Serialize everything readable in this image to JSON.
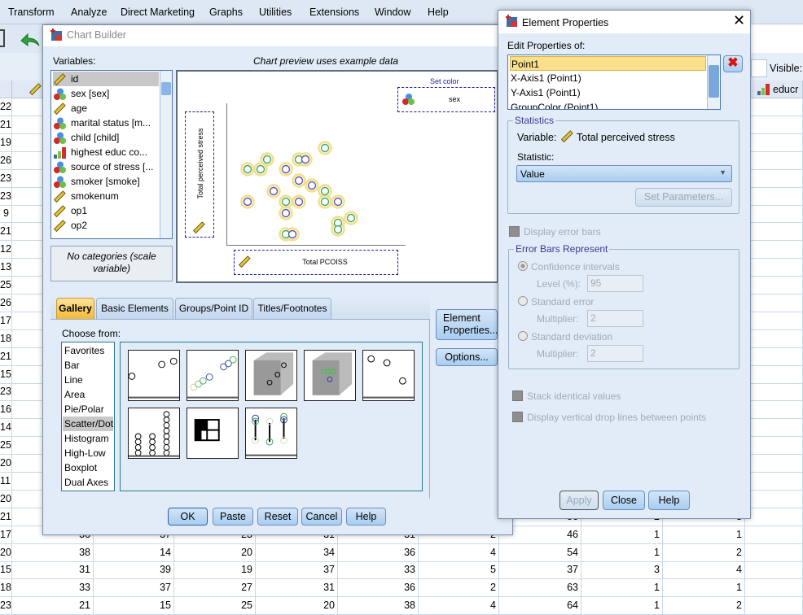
{
  "menu": [
    "Transform",
    "Analyze",
    "Direct Marketing",
    "Graphs",
    "Utilities",
    "Extensions",
    "Window",
    "Help"
  ],
  "data_editor": {
    "visible_label": "Visible:",
    "right_column_header": "educr",
    "first_column_values": [
      "22",
      "21",
      "19",
      "26",
      "23",
      "23",
      "9",
      "21",
      "12",
      "13",
      "25",
      "26",
      "17",
      "18",
      "21",
      "15",
      "23",
      "16",
      "14",
      "25",
      "20",
      "11",
      "20",
      "21",
      "17",
      "20",
      "15",
      "18",
      "23"
    ],
    "bottom_rows": [
      [
        "",
        "",
        "",
        "",
        "",
        "",
        "56",
        "2",
        "3"
      ],
      [
        "36",
        "37",
        "23",
        "31",
        "31",
        "2",
        "46",
        "1",
        "1"
      ],
      [
        "38",
        "14",
        "20",
        "34",
        "36",
        "4",
        "54",
        "1",
        "2"
      ],
      [
        "31",
        "39",
        "19",
        "37",
        "33",
        "5",
        "37",
        "3",
        "4"
      ],
      [
        "33",
        "37",
        "27",
        "31",
        "36",
        "2",
        "63",
        "1",
        "1"
      ],
      [
        "21",
        "15",
        "25",
        "20",
        "38",
        "4",
        "64",
        "1",
        "2"
      ]
    ]
  },
  "chart_builder": {
    "title": "Chart Builder",
    "variables_label": "Variables:",
    "preview_label": "Chart preview uses example data",
    "variables": [
      {
        "label": "id",
        "icon": "scale"
      },
      {
        "label": "sex [sex]",
        "icon": "nominal"
      },
      {
        "label": "age",
        "icon": "scale"
      },
      {
        "label": "marital status [m...",
        "icon": "nominal"
      },
      {
        "label": "child [child]",
        "icon": "nominal"
      },
      {
        "label": "highest educ co...",
        "icon": "ordinal"
      },
      {
        "label": "source of stress [...",
        "icon": "nominal"
      },
      {
        "label": "smoker [smoke]",
        "icon": "nominal"
      },
      {
        "label": "smokenum",
        "icon": "scale"
      },
      {
        "label": "op1",
        "icon": "scale"
      },
      {
        "label": "op2",
        "icon": "scale"
      }
    ],
    "selected_variable": "id",
    "categories_text": "No categories (scale variable)",
    "y_axis_variable": "Total perceived stress",
    "x_axis_variable": "Total PCOISS",
    "set_color_label": "Set color",
    "color_variable": "sex",
    "tabs": [
      "Gallery",
      "Basic Elements",
      "Groups/Point ID",
      "Titles/Footnotes"
    ],
    "active_tab": "Gallery",
    "choose_from_label": "Choose from:",
    "chart_types": [
      "Favorites",
      "Bar",
      "Line",
      "Area",
      "Pie/Polar",
      "Scatter/Dot",
      "Histogram",
      "High-Low",
      "Boxplot",
      "Dual Axes"
    ],
    "selected_chart_type": "Scatter/Dot",
    "element_properties_button": "Element Properties...",
    "options_button": "Options...",
    "buttons": {
      "ok": "OK",
      "paste": "Paste",
      "reset": "Reset",
      "cancel": "Cancel",
      "help": "Help"
    }
  },
  "element_properties": {
    "title": "Element Properties",
    "edit_label": "Edit Properties of:",
    "items": [
      "Point1",
      "X-Axis1 (Point1)",
      "Y-Axis1 (Point1)",
      "GroupColor (Point1)"
    ],
    "selected_item": "Point1",
    "statistics_group": "Statistics",
    "variable_label": "Variable:",
    "variable_value": "Total perceived stress",
    "statistic_label": "Statistic:",
    "statistic_value": "Value",
    "set_parameters": "Set Parameters...",
    "display_error_bars": "Display error bars",
    "error_bars_group": "Error Bars Represent",
    "confidence_intervals": "Confidence intervals",
    "level_label": "Level (%):",
    "level_value": "95",
    "standard_error": "Standard error",
    "multiplier_label": "Multiplier:",
    "se_multiplier": "2",
    "standard_deviation": "Standard deviation",
    "sd_multiplier": "2",
    "stack_identical": "Stack identical values",
    "drop_lines": "Display vertical drop lines between points",
    "buttons": {
      "apply": "Apply",
      "close": "Close",
      "help": "Help"
    }
  }
}
